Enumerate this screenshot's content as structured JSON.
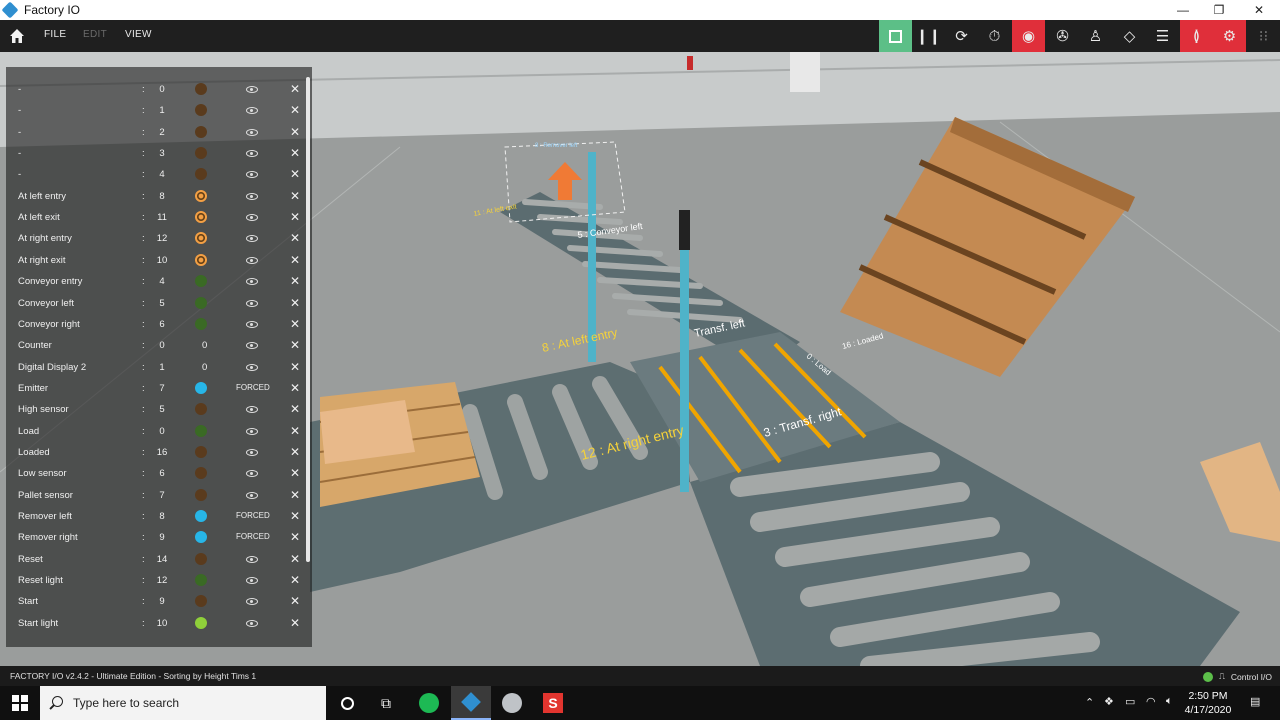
{
  "window": {
    "title": "Factory IO",
    "minimize": "—",
    "maximize": "❐",
    "close": "✕"
  },
  "menu": {
    "file": "FILE",
    "edit": "EDIT",
    "view": "VIEW"
  },
  "scene_labels": {
    "at_left_entry": "8 : At left entry",
    "at_right_entry": "12 : At right entry",
    "transf_left": "Transf. left",
    "transf_right": "3 : Transf. right",
    "conveyor_left": "5 : Conveyor left",
    "at_left_exit": "11 : At left exit",
    "remover_left": "8 : Remover left",
    "load": "0 : Load",
    "loaded": "16 : Loaded"
  },
  "tags": [
    {
      "name": "-",
      "addr": "0",
      "indicator": "orange-off"
    },
    {
      "name": "-",
      "addr": "1",
      "indicator": "orange-off"
    },
    {
      "name": "-",
      "addr": "2",
      "indicator": "orange-off"
    },
    {
      "name": "-",
      "addr": "3",
      "indicator": "orange-off"
    },
    {
      "name": "-",
      "addr": "4",
      "indicator": "orange-off"
    },
    {
      "name": "At left entry",
      "addr": "8",
      "indicator": "orange"
    },
    {
      "name": "At left exit",
      "addr": "11",
      "indicator": "orange"
    },
    {
      "name": "At right entry",
      "addr": "12",
      "indicator": "orange"
    },
    {
      "name": "At right exit",
      "addr": "10",
      "indicator": "orange"
    },
    {
      "name": "Conveyor entry",
      "addr": "4",
      "indicator": "green"
    },
    {
      "name": "Conveyor left",
      "addr": "5",
      "indicator": "green"
    },
    {
      "name": "Conveyor right",
      "addr": "6",
      "indicator": "green"
    },
    {
      "name": "Counter",
      "addr": "0",
      "value": "0"
    },
    {
      "name": "Digital Display 2",
      "addr": "1",
      "value": "0"
    },
    {
      "name": "Emitter",
      "addr": "7",
      "indicator": "blue",
      "status": "FORCED"
    },
    {
      "name": "High sensor",
      "addr": "5",
      "indicator": "orange-off"
    },
    {
      "name": "Load",
      "addr": "0",
      "indicator": "green"
    },
    {
      "name": "Loaded",
      "addr": "16",
      "indicator": "orange-off"
    },
    {
      "name": "Low sensor",
      "addr": "6",
      "indicator": "orange-off"
    },
    {
      "name": "Pallet sensor",
      "addr": "7",
      "indicator": "orange-off"
    },
    {
      "name": "Remover left",
      "addr": "8",
      "indicator": "blue",
      "status": "FORCED"
    },
    {
      "name": "Remover right",
      "addr": "9",
      "indicator": "blue",
      "status": "FORCED"
    },
    {
      "name": "Reset",
      "addr": "14",
      "indicator": "orange-off"
    },
    {
      "name": "Reset light",
      "addr": "12",
      "indicator": "green"
    },
    {
      "name": "Start",
      "addr": "9",
      "indicator": "orange-off"
    },
    {
      "name": "Start light",
      "addr": "10",
      "indicator": "green-on"
    }
  ],
  "status": {
    "text": "FACTORY I/O v2.4.2 - Ultimate Edition - Sorting by Height Tims 1",
    "control": "Control I/O"
  },
  "taskbar": {
    "search_placeholder": "Type here to search",
    "time": "2:50 PM",
    "date": "4/17/2020"
  },
  "colors": {
    "accent_green": "#5cbf87",
    "accent_red": "#e02f3a",
    "force_blue": "#27b6e8"
  }
}
